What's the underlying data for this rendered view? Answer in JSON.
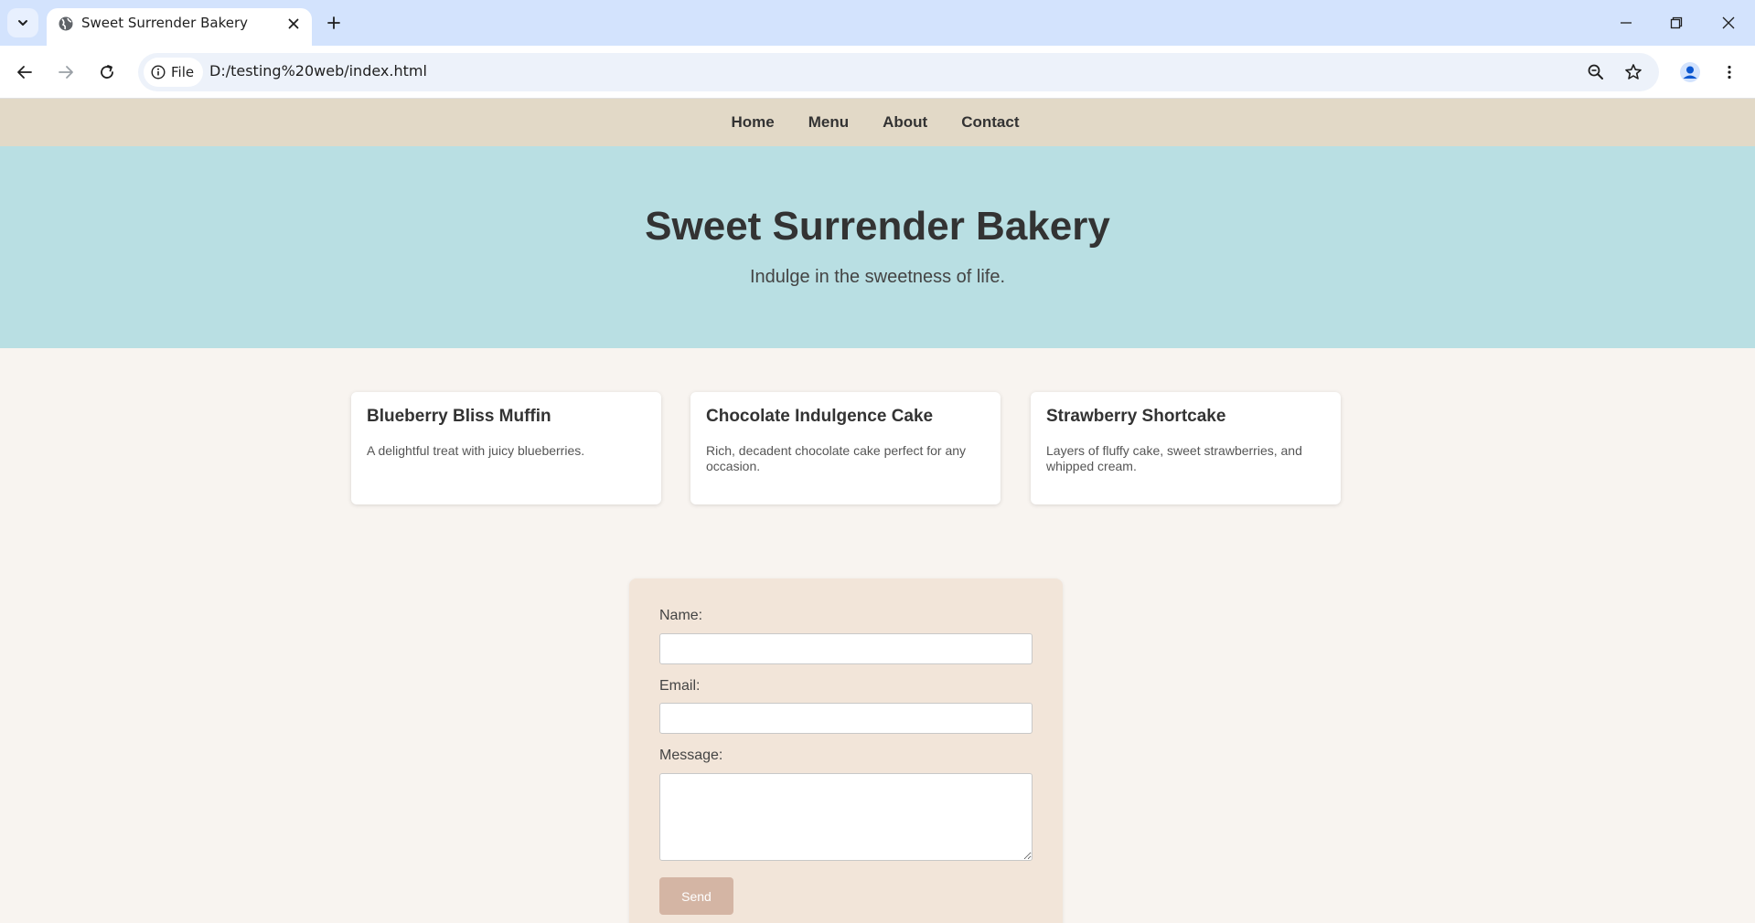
{
  "browser": {
    "tab_title": "Sweet Surrender Bakery",
    "chip_label": "File",
    "url": "D:/testing%20web/index.html",
    "colors": {
      "tabbar": "#d3e3fd",
      "omnibox": "#edf2fa"
    }
  },
  "nav": {
    "items": [
      "Home",
      "Menu",
      "About",
      "Contact"
    ]
  },
  "hero": {
    "title": "Sweet Surrender Bakery",
    "tagline": "Indulge in the sweetness of life."
  },
  "cards": [
    {
      "title": "Blueberry Bliss Muffin",
      "description": "A delightful treat with juicy blueberries."
    },
    {
      "title": "Chocolate Indulgence Cake",
      "description": "Rich, decadent chocolate cake perfect for any occasion."
    },
    {
      "title": "Strawberry Shortcake",
      "description": "Layers of fluffy cake, sweet strawberries, and whipped cream."
    }
  ],
  "form": {
    "name_label": "Name:",
    "email_label": "Email:",
    "message_label": "Message:",
    "name_value": "",
    "email_value": "",
    "message_value": "",
    "send_label": "Send"
  },
  "colors": {
    "nav_bg": "#e2d9c7",
    "hero_bg": "#b9dfe3",
    "page_bg": "#f8f4f0",
    "form_bg": "#f2e5d9",
    "send_button": "#d4b5a4"
  }
}
